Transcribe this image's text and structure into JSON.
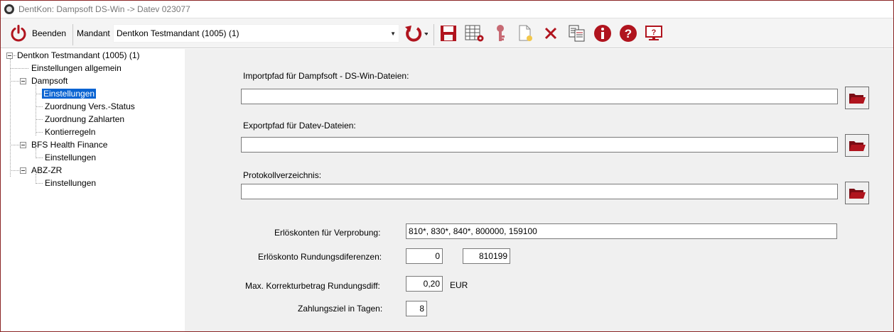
{
  "window": {
    "title": "DentKon: Dampsoft DS-Win -> Datev 023077"
  },
  "toolbar": {
    "exit_label": "Beenden",
    "mandant_label": "Mandant",
    "mandant_value": "Dentkon Testmandant (1005) (1)",
    "icons": [
      "refresh-icon",
      "save-icon",
      "table-settings-icon",
      "key-icon",
      "new-document-icon",
      "delete-icon",
      "copy-icon",
      "info-icon",
      "help-icon",
      "remote-support-icon"
    ]
  },
  "tree": {
    "root": "Dentkon Testmandant (1005) (1)",
    "general": "Einstellungen allgemein",
    "dampsoft": {
      "label": "Dampsoft",
      "children": [
        "Einstellungen",
        "Zuordnung Vers.-Status",
        "Zuordnung Zahlarten",
        "Kontierregeln"
      ]
    },
    "bfs": {
      "label": "BFS Health Finance",
      "children": [
        "Einstellungen"
      ]
    },
    "abz": {
      "label": "ABZ-ZR",
      "children": [
        "Einstellungen"
      ]
    },
    "selected": "Dampsoft > Einstellungen"
  },
  "form": {
    "import_label": "Importpfad für Dampfsoft - DS-Win-Dateien:",
    "import_value": "",
    "export_label": "Exportpfad für Datev-Dateien:",
    "export_value": "",
    "log_label": "Protokollverzeichnis:",
    "log_value": "",
    "revenue_accounts_label": "Erlöskonten für Verprobung:",
    "revenue_accounts_value": "810*, 830*, 840*, 800000, 159100",
    "rounding_account_label": "Erlöskonto Rundungsdiferenzen:",
    "rounding_account_value1": "0",
    "rounding_account_value2": "810199",
    "max_correction_label": "Max. Korrekturbetrag Rundungsdiff:",
    "max_correction_value": "0,20",
    "currency": "EUR",
    "payment_term_label": "Zahlungsziel in Tagen:",
    "payment_term_value": "8"
  },
  "colors": {
    "accent_red": "#b0141e",
    "selection": "#0a64d2",
    "window_border": "#8a2424"
  }
}
